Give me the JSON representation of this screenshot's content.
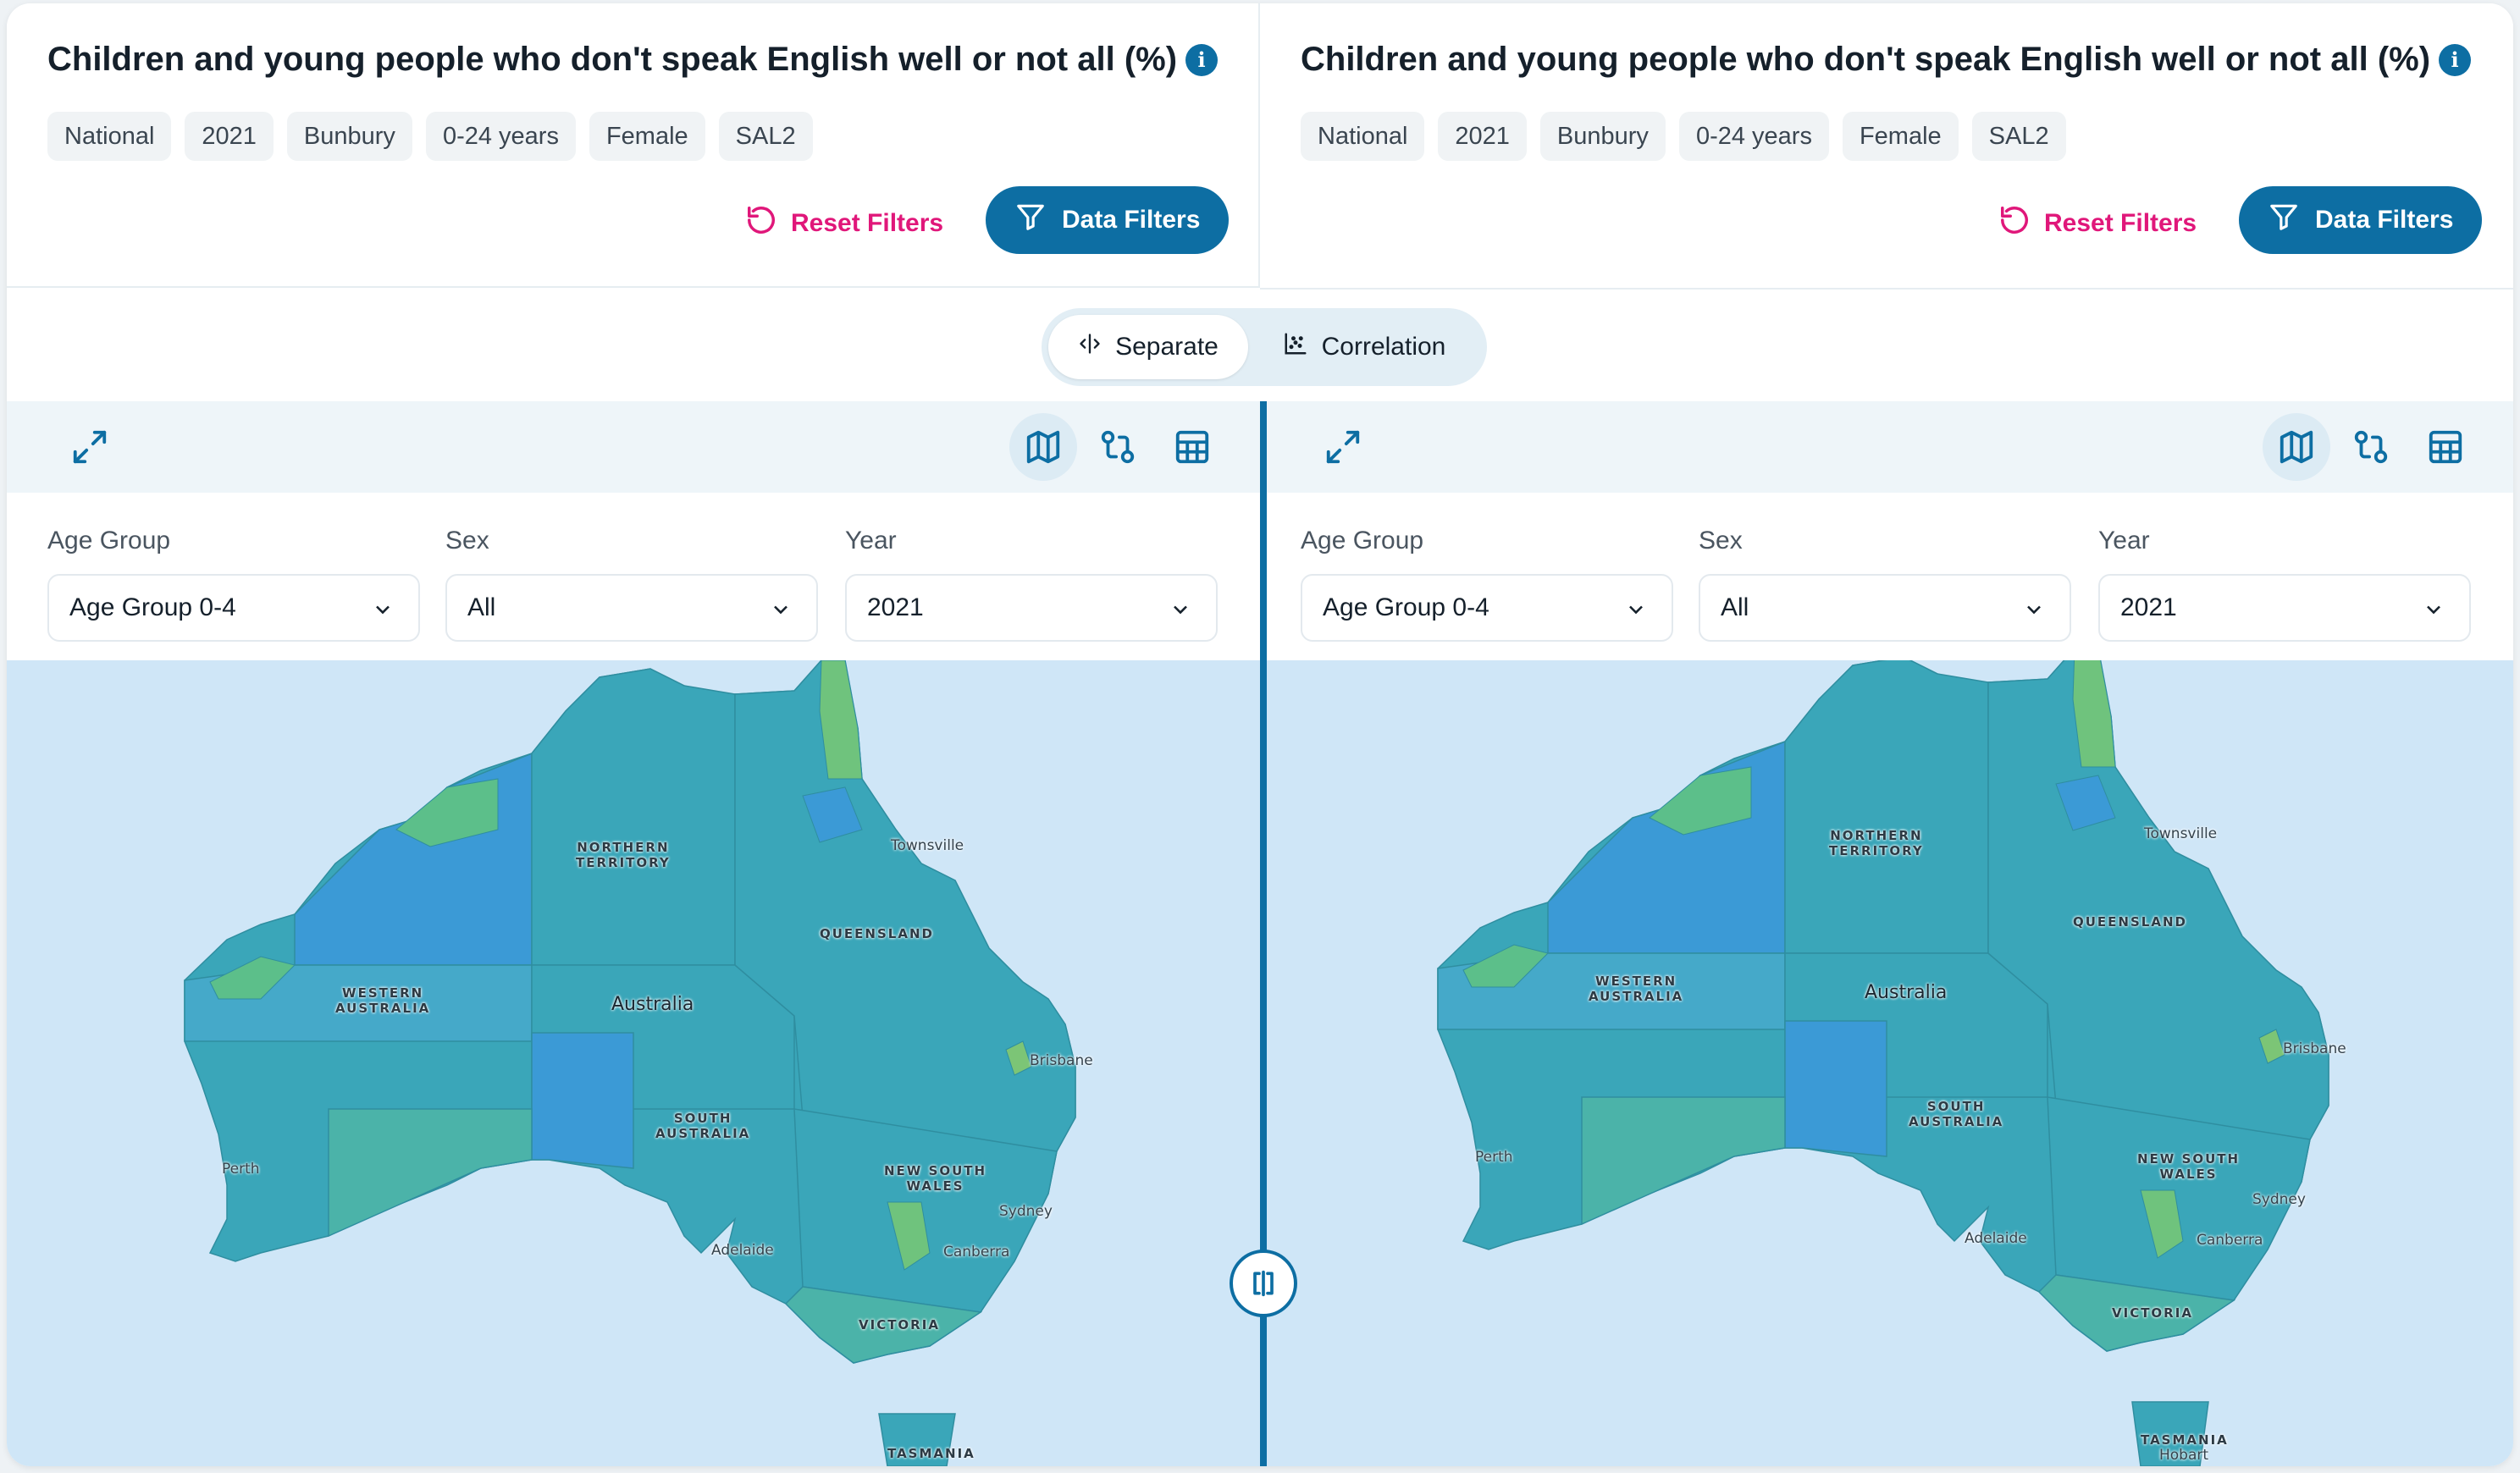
{
  "left_panel": {
    "title": "Children and young people who don't speak English well or not all (%)",
    "tags": [
      "National",
      "2021",
      "Bunbury",
      "0-24 years",
      "Female",
      "SAL2"
    ],
    "reset_label": "Reset Filters",
    "data_filters_label": "Data Filters",
    "filters": {
      "age_group_label": "Age Group",
      "age_group_value": "Age Group 0-4",
      "sex_label": "Sex",
      "sex_value": "All",
      "year_label": "Year",
      "year_value": "2021"
    },
    "map_labels": {
      "northern_territory": "NORTHERN\nTERRITORY",
      "queensland": "QUEENSLAND",
      "western_australia": "WESTERN\nAUSTRALIA",
      "australia": "Australia",
      "south_australia": "SOUTH\nAUSTRALIA",
      "new_south_wales": "NEW SOUTH\nWALES",
      "victoria": "VICTORIA",
      "tasmania": "TASMANIA",
      "townsville": "Townsville",
      "brisbane": "Brisbane",
      "sydney": "Sydney",
      "canberra": "Canberra",
      "adelaide": "Adelaide",
      "perth": "Perth"
    }
  },
  "right_panel": {
    "title": "Children and young people who don't speak English well or not all (%)",
    "tags": [
      "National",
      "2021",
      "Bunbury",
      "0-24 years",
      "Female",
      "SAL2"
    ],
    "reset_label": "Reset Filters",
    "data_filters_label": "Data Filters",
    "filters": {
      "age_group_label": "Age Group",
      "age_group_value": "Age Group 0-4",
      "sex_label": "Sex",
      "sex_value": "All",
      "year_label": "Year",
      "year_value": "2021"
    },
    "map_labels": {
      "northern_territory": "NORTHERN\nTERRITORY",
      "queensland": "QUEENSLAND",
      "western_australia": "WESTERN\nAUSTRALIA",
      "australia": "Australia",
      "south_australia": "SOUTH\nAUSTRALIA",
      "new_south_wales": "NEW SOUTH\nWALES",
      "victoria": "VICTORIA",
      "tasmania": "TASMANIA",
      "townsville": "Townsville",
      "brisbane": "Brisbane",
      "sydney": "Sydney",
      "canberra": "Canberra",
      "adelaide": "Adelaide",
      "perth": "Perth",
      "hobart": "Hobart"
    }
  },
  "mode_toggle": {
    "separate_label": "Separate",
    "correlation_label": "Correlation",
    "active": "Separate"
  },
  "colors": {
    "primary": "#0d6ea3",
    "reset": "#e0177a",
    "ocean": "#cfe6f7",
    "region_teal": "#3aa6b9",
    "region_blue": "#3b9ad6",
    "region_green": "#5cbf8a",
    "region_lime": "#7cc576"
  },
  "icons": {
    "info": "info-icon",
    "reset": "reset-icon",
    "filter": "filter-icon",
    "separate": "split-icon",
    "correlation": "scatter-icon",
    "expand": "expand-icon",
    "map": "map-icon",
    "compare": "compare-icon",
    "table": "table-icon",
    "chevron": "chevron-down-icon",
    "divider": "divider-handle-icon"
  }
}
